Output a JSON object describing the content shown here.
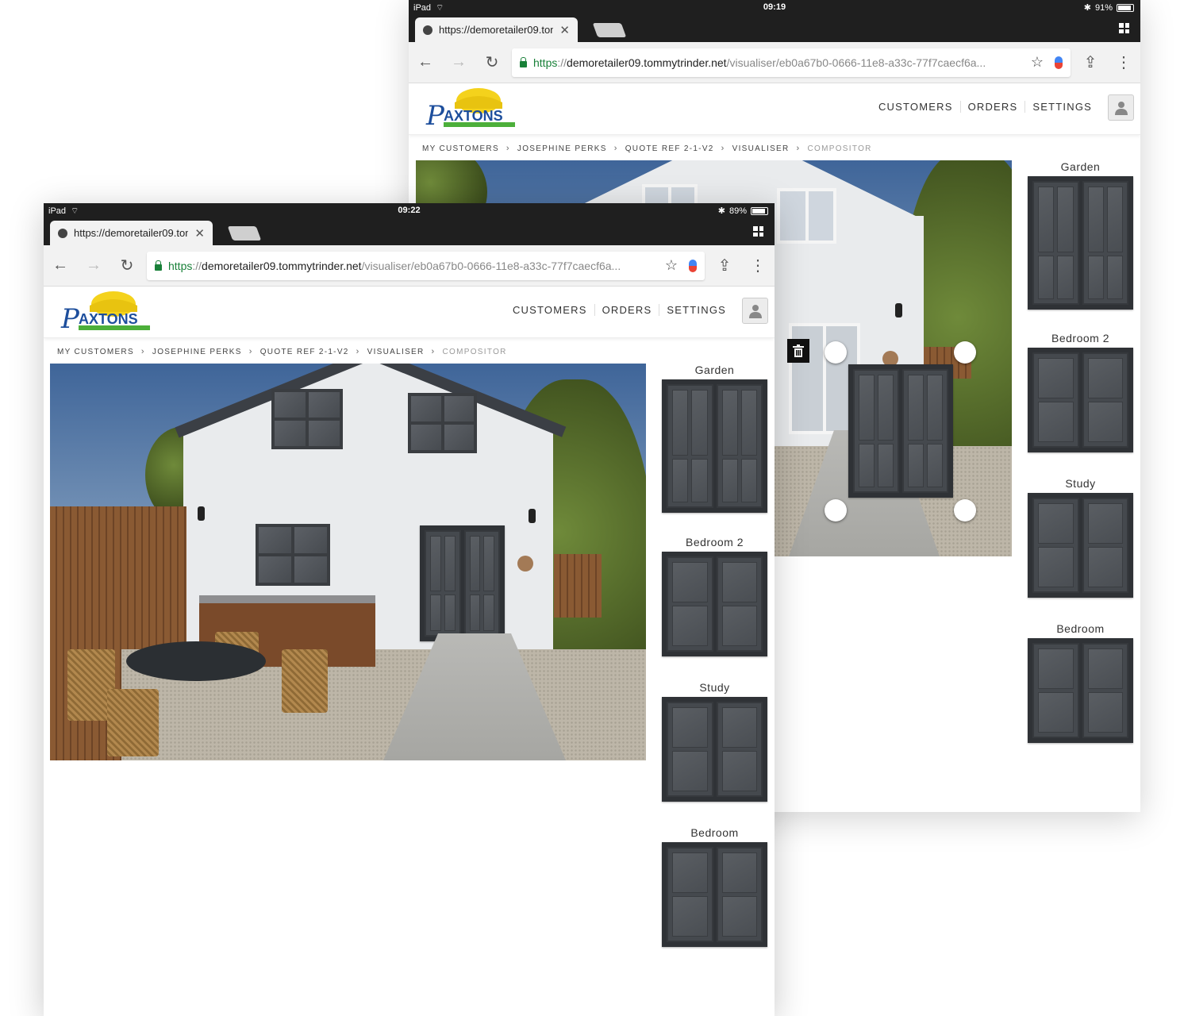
{
  "back": {
    "status": {
      "device": "iPad",
      "time": "09:19",
      "battery": "91%",
      "battery_fraction": 0.91
    },
    "tab": {
      "title": "https://demoretailer09.tom"
    },
    "url": {
      "scheme": "https",
      "sep": "://",
      "host": "demoretailer09.tommytrinder.net",
      "path": "/visualiser/eb0a67b0-0666-11e8-a33c-77f7caecf6a..."
    },
    "nav": {
      "customers": "CUSTOMERS",
      "orders": "ORDERS",
      "settings": "SETTINGS"
    },
    "breadcrumb": [
      "MY CUSTOMERS",
      "JOSEPHINE PERKS",
      "QUOTE REF 2-1-V2",
      "VISUALISER",
      "COMPOSITOR"
    ],
    "catalog": [
      "Garden",
      "Bedroom 2",
      "Study",
      "Bedroom"
    ]
  },
  "front": {
    "status": {
      "device": "iPad",
      "time": "09:22",
      "battery": "89%",
      "battery_fraction": 0.89
    },
    "tab": {
      "title": "https://demoretailer09.tom"
    },
    "url": {
      "scheme": "https",
      "sep": "://",
      "host": "demoretailer09.tommytrinder.net",
      "path": "/visualiser/eb0a67b0-0666-11e8-a33c-77f7caecf6a..."
    },
    "nav": {
      "customers": "CUSTOMERS",
      "orders": "ORDERS",
      "settings": "SETTINGS"
    },
    "breadcrumb": [
      "MY CUSTOMERS",
      "JOSEPHINE PERKS",
      "QUOTE REF 2-1-V2",
      "VISUALISER",
      "COMPOSITOR"
    ],
    "catalog": [
      "Garden",
      "Bedroom 2",
      "Study",
      "Bedroom"
    ]
  },
  "colors": {
    "accent_green": "#188038",
    "dark_chrome": "#1f1f1f",
    "frame_grey": "#3a3d41"
  },
  "icons": [
    "wifi-icon",
    "bluetooth-icon",
    "battery-icon",
    "back-arrow-icon",
    "forward-arrow-icon",
    "reload-icon",
    "lock-icon",
    "star-icon",
    "mic-icon",
    "share-icon",
    "more-icon",
    "tab-switcher-icon",
    "user-icon",
    "trash-icon",
    "chevron-right-icon"
  ]
}
